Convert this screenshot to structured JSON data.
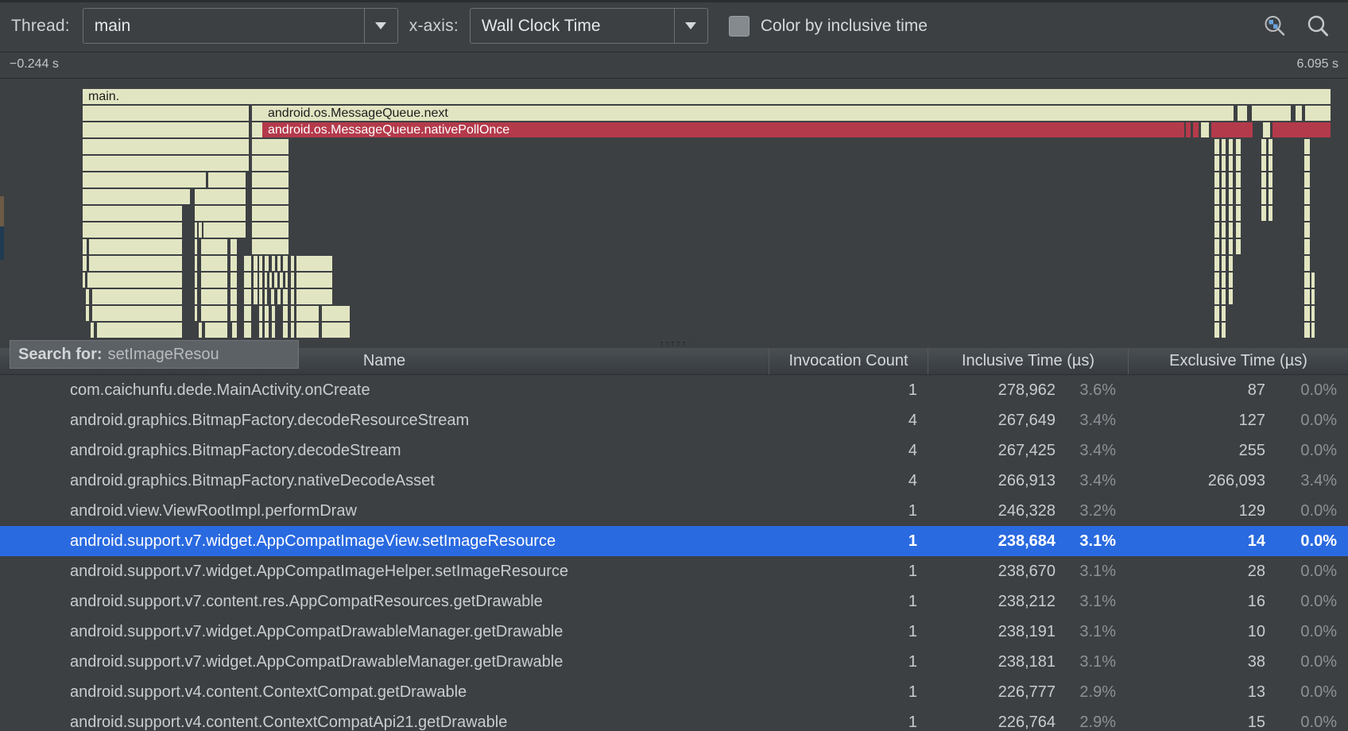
{
  "toolbar": {
    "thread_label": "Thread:",
    "thread_value": "main",
    "xaxis_label": "x-axis:",
    "xaxis_value": "Wall Clock Time",
    "color_by_inclusive_label": "Color by inclusive time",
    "zoom_select_icon": "zoom-select-icon",
    "search_icon": "search-icon"
  },
  "ruler": {
    "start": "−0.244 s",
    "end": "6.095 s"
  },
  "flame": {
    "rows": [
      {
        "label": "main.",
        "color": "#e2e5c1"
      },
      {
        "label": "android.os.MessageQueue.next",
        "color": "#e2e5c1"
      },
      {
        "label": "android.os.MessageQueue.nativePollOnce",
        "color": "#b33a4b"
      }
    ]
  },
  "search": {
    "label": "Search for:",
    "value": "setImageResou"
  },
  "table": {
    "columns": [
      "Name",
      "Invocation Count",
      "Inclusive Time (µs)",
      "Exclusive Time (µs)"
    ],
    "rows": [
      {
        "name": "com.caichunfu.dede.MainActivity.onCreate",
        "invocations": "1",
        "inclusive": "278,962",
        "inclusive_pct": "3.6%",
        "exclusive": "87",
        "exclusive_pct": "0.0%",
        "selected": false
      },
      {
        "name": "android.graphics.BitmapFactory.decodeResourceStream",
        "invocations": "4",
        "inclusive": "267,649",
        "inclusive_pct": "3.4%",
        "exclusive": "127",
        "exclusive_pct": "0.0%",
        "selected": false
      },
      {
        "name": "android.graphics.BitmapFactory.decodeStream",
        "invocations": "4",
        "inclusive": "267,425",
        "inclusive_pct": "3.4%",
        "exclusive": "255",
        "exclusive_pct": "0.0%",
        "selected": false
      },
      {
        "name": "android.graphics.BitmapFactory.nativeDecodeAsset",
        "invocations": "4",
        "inclusive": "266,913",
        "inclusive_pct": "3.4%",
        "exclusive": "266,093",
        "exclusive_pct": "3.4%",
        "selected": false
      },
      {
        "name": "android.view.ViewRootImpl.performDraw",
        "invocations": "1",
        "inclusive": "246,328",
        "inclusive_pct": "3.2%",
        "exclusive": "129",
        "exclusive_pct": "0.0%",
        "selected": false
      },
      {
        "name": "android.support.v7.widget.AppCompatImageView.setImageResource",
        "invocations": "1",
        "inclusive": "238,684",
        "inclusive_pct": "3.1%",
        "exclusive": "14",
        "exclusive_pct": "0.0%",
        "selected": true
      },
      {
        "name": "android.support.v7.widget.AppCompatImageHelper.setImageResource",
        "invocations": "1",
        "inclusive": "238,670",
        "inclusive_pct": "3.1%",
        "exclusive": "28",
        "exclusive_pct": "0.0%",
        "selected": false
      },
      {
        "name": "android.support.v7.content.res.AppCompatResources.getDrawable",
        "invocations": "1",
        "inclusive": "238,212",
        "inclusive_pct": "3.1%",
        "exclusive": "16",
        "exclusive_pct": "0.0%",
        "selected": false
      },
      {
        "name": "android.support.v7.widget.AppCompatDrawableManager.getDrawable",
        "invocations": "1",
        "inclusive": "238,191",
        "inclusive_pct": "3.1%",
        "exclusive": "10",
        "exclusive_pct": "0.0%",
        "selected": false
      },
      {
        "name": "android.support.v7.widget.AppCompatDrawableManager.getDrawable",
        "invocations": "1",
        "inclusive": "238,181",
        "inclusive_pct": "3.1%",
        "exclusive": "38",
        "exclusive_pct": "0.0%",
        "selected": false
      },
      {
        "name": "android.support.v4.content.ContextCompat.getDrawable",
        "invocations": "1",
        "inclusive": "226,777",
        "inclusive_pct": "2.9%",
        "exclusive": "13",
        "exclusive_pct": "0.0%",
        "selected": false
      },
      {
        "name": "android.support.v4.content.ContextCompatApi21.getDrawable",
        "invocations": "1",
        "inclusive": "226,764",
        "inclusive_pct": "2.9%",
        "exclusive": "15",
        "exclusive_pct": "0.0%",
        "selected": false
      }
    ]
  },
  "colors": {
    "background": "#3c4043",
    "frame_fill": "#e2e5c1",
    "frame_highlight": "#b33a4b",
    "selection": "#2a6ae0"
  }
}
